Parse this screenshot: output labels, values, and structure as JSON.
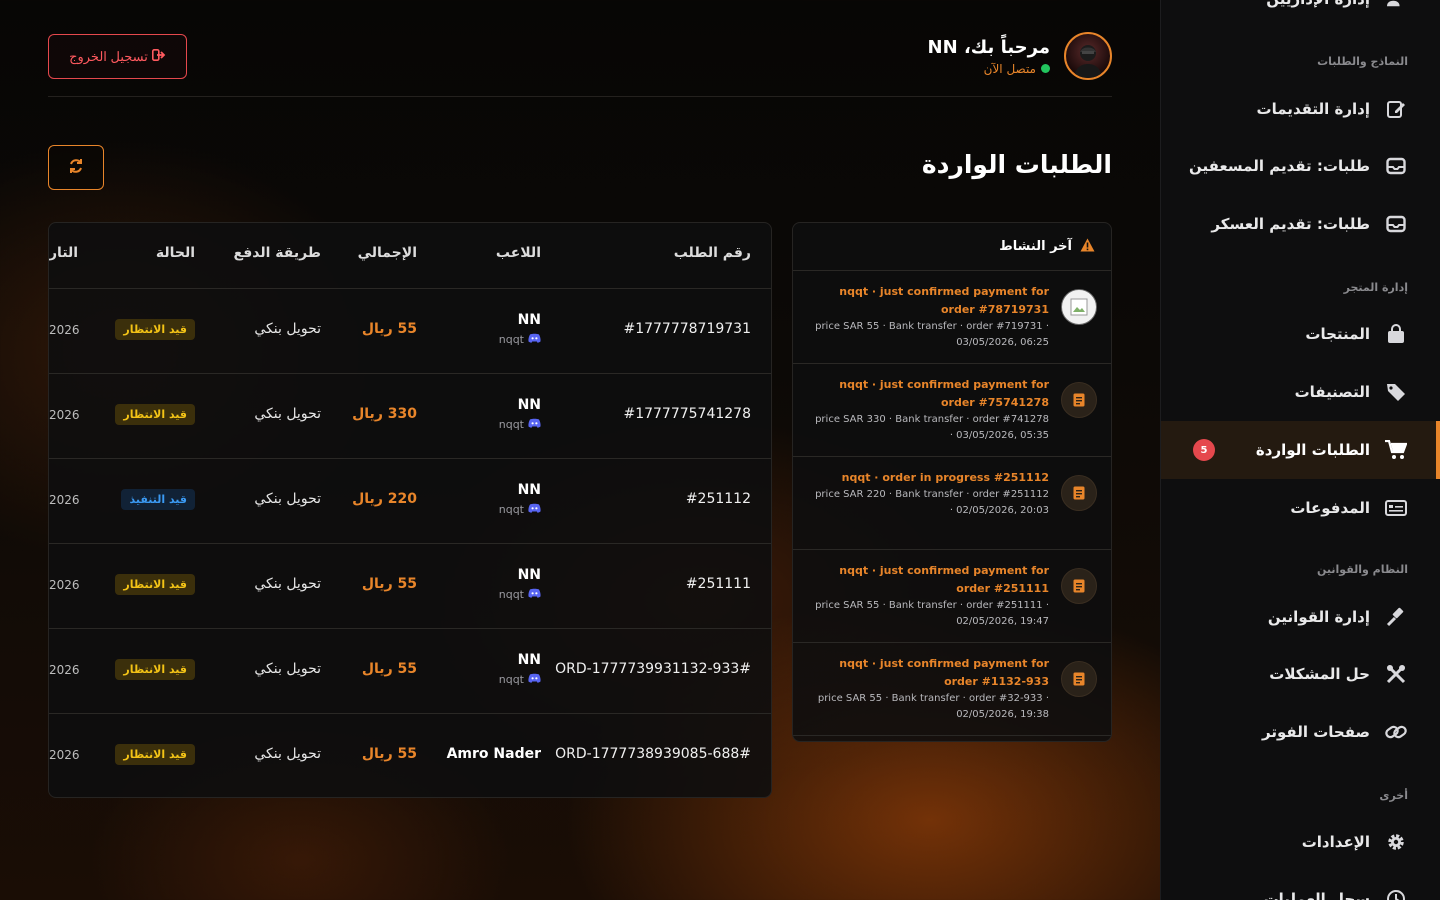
{
  "header": {
    "logout_label": "تسجيل الخروج",
    "welcome": "مرحباً بك، NN",
    "status": "متصل الآن",
    "page_title": "الطلبات الواردة"
  },
  "sidebar": {
    "partial_top": "إدارة الإداريين",
    "sections": [
      {
        "label": "النماذج والطلبات"
      },
      {
        "label": "إدارة المتجر"
      },
      {
        "label": "النظام والقوانين"
      },
      {
        "label": "أخرى"
      }
    ],
    "items": [
      {
        "label": "إدارة التقديمات",
        "icon": "edit-icon"
      },
      {
        "label": "طلبات: تقديم المسعفين",
        "icon": "inbox-icon"
      },
      {
        "label": "طلبات: تقديم العسكر",
        "icon": "inbox-icon"
      },
      {
        "label": "المنتجات",
        "icon": "bag-icon"
      },
      {
        "label": "التصنيفات",
        "icon": "tags-icon"
      },
      {
        "label": "الطلبات الواردة",
        "icon": "cart-icon",
        "badge": "5",
        "active": true
      },
      {
        "label": "المدفوعات",
        "icon": "card-icon"
      },
      {
        "label": "إدارة القوانين",
        "icon": "gavel-icon"
      },
      {
        "label": "حل المشكلات",
        "icon": "tools-icon"
      },
      {
        "label": "صفحات الفوتر",
        "icon": "link-icon"
      },
      {
        "label": "الإعدادات",
        "icon": "gear-icon"
      },
      {
        "label": "سجل العمليات",
        "icon": "history-icon"
      }
    ]
  },
  "table": {
    "headers": {
      "order": "رقم الطلب",
      "player": "اللاعب",
      "total": "الإجمالي",
      "payment": "طريقة الدفع",
      "status": "الحالة",
      "date": "التار"
    },
    "rows": [
      {
        "order": "#1777778719731",
        "player": "NN",
        "player_sub": "nqqt",
        "total": "55 ريال",
        "payment": "تحويل بنكي",
        "status": "قيد الانتظار",
        "status_type": "wait",
        "date": "2026"
      },
      {
        "order": "#1777775741278",
        "player": "NN",
        "player_sub": "nqqt",
        "total": "330 ريال",
        "payment": "تحويل بنكي",
        "status": "قيد الانتظار",
        "status_type": "wait",
        "date": "2026"
      },
      {
        "order": "#251112",
        "player": "NN",
        "player_sub": "nqqt",
        "total": "220 ريال",
        "payment": "تحويل بنكي",
        "status": "قيد التنفيذ",
        "status_type": "exec",
        "date": "2026"
      },
      {
        "order": "#251111",
        "player": "NN",
        "player_sub": "nqqt",
        "total": "55 ريال",
        "payment": "تحويل بنكي",
        "status": "قيد الانتظار",
        "status_type": "wait",
        "date": "2026"
      },
      {
        "order": "ORD-1777739931132-933#",
        "player": "NN",
        "player_sub": "nqqt",
        "total": "55 ريال",
        "payment": "تحويل بنكي",
        "status": "قيد الانتظار",
        "status_type": "wait",
        "date": "2026"
      },
      {
        "order": "ORD-1777738939085-688#",
        "player": "Amro Nader",
        "player_sub": "",
        "total": "55 ريال",
        "payment": "تحويل بنكي",
        "status": "قيد الانتظار",
        "status_type": "wait",
        "date": "2026"
      }
    ]
  },
  "activity": {
    "title": "آخر النشاط",
    "items": [
      {
        "line1": "nqqt · just confirmed payment for order #78719731",
        "line2": "price SAR 55 · Bank transfer · order #719731 · 03/05/2026, 06:25",
        "icon": "image-icon"
      },
      {
        "line1": "nqqt · just confirmed payment for order #75741278",
        "line2": "price SAR 330 · Bank transfer · order #741278 · 03/05/2026, 05:35",
        "icon": "receipt-icon"
      },
      {
        "line1": "nqqt · order in progress #251112",
        "line2": "price SAR 220 · Bank transfer · order #251112 · 02/05/2026, 20:03",
        "icon": "receipt-icon"
      },
      {
        "line1": "nqqt · just confirmed payment for order #251111",
        "line2": "price SAR 55 · Bank transfer · order #251111 · 02/05/2026, 19:47",
        "icon": "receipt-icon"
      },
      {
        "line1": "nqqt · just confirmed payment for order #1132-933",
        "line2": "price SAR 55 · Bank transfer · order #32-933 · 02/05/2026, 19:38",
        "icon": "receipt-icon"
      }
    ]
  },
  "colors": {
    "accent": "#e8852a",
    "danger": "#e5484d",
    "wait": "#f3c316",
    "exec": "#3b9af3",
    "online": "#22c55e"
  }
}
